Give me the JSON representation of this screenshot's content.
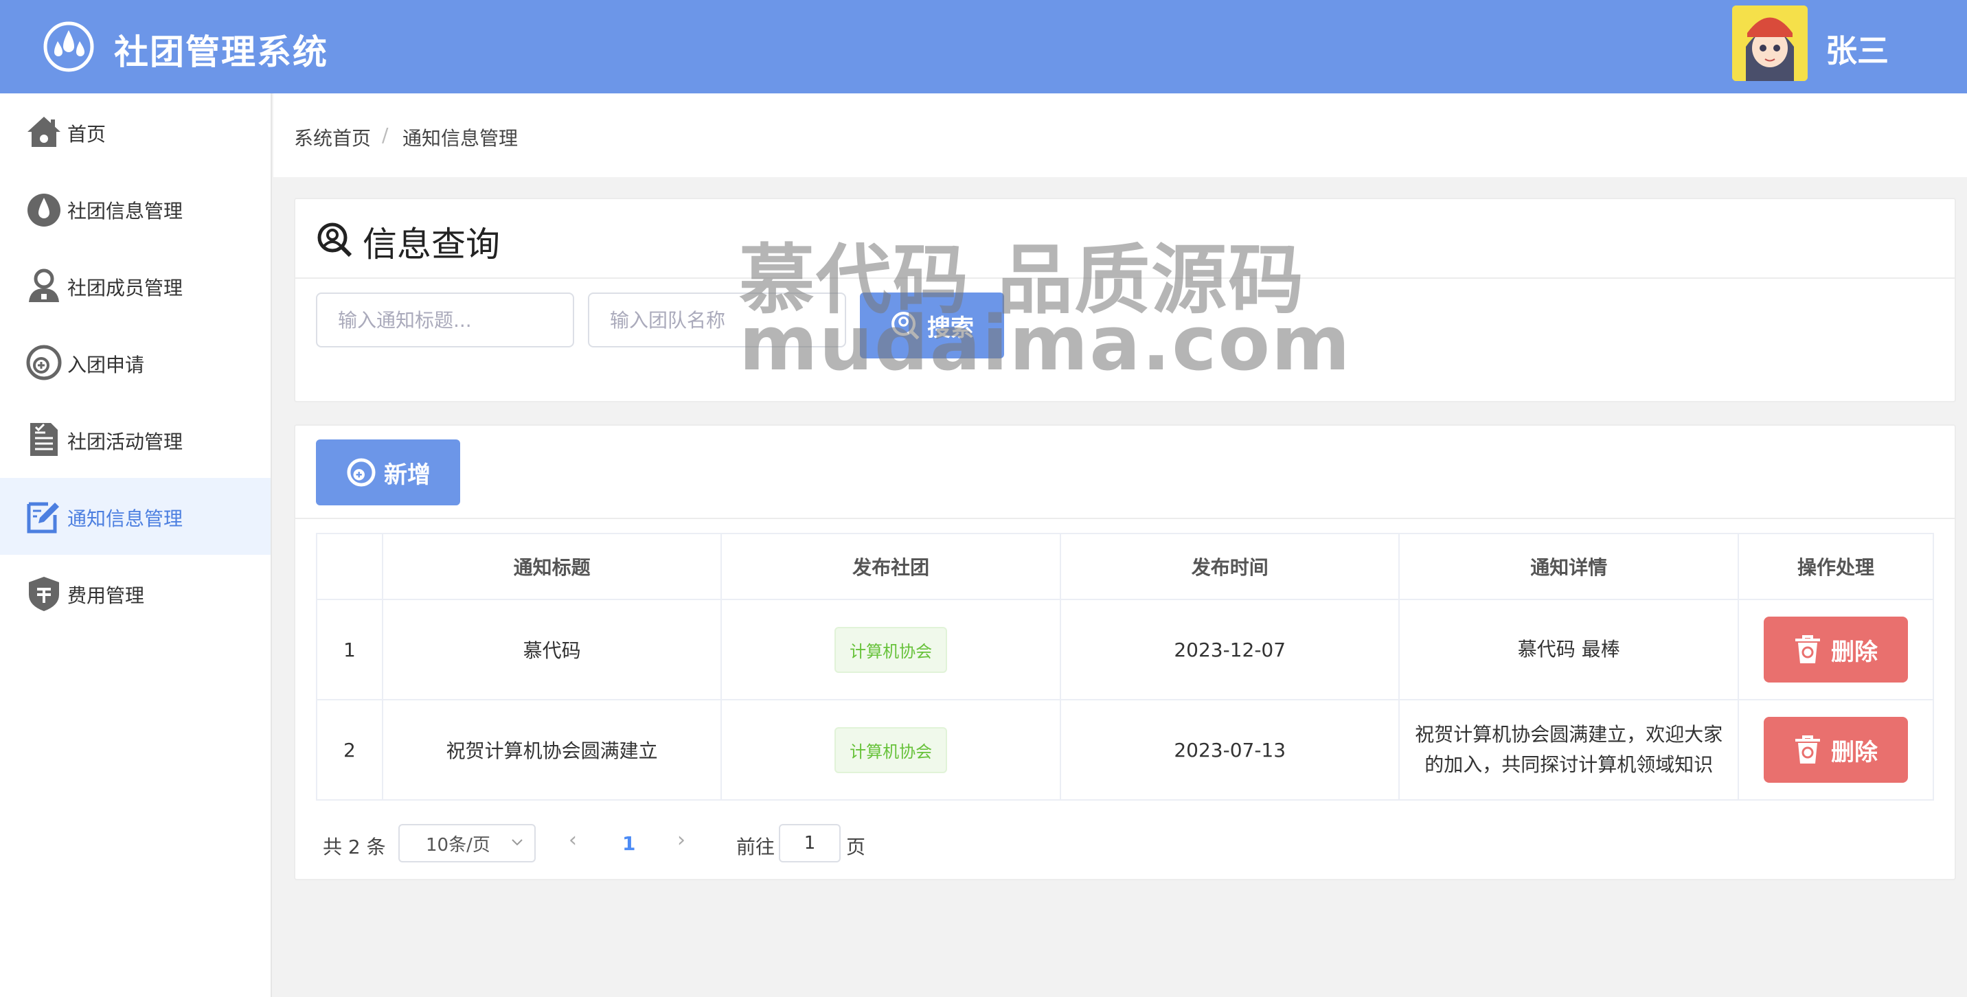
{
  "header": {
    "app_title": "社团管理系统",
    "username": "张三"
  },
  "sidebar": {
    "items": [
      {
        "label": "首页",
        "icon": "home-icon"
      },
      {
        "label": "社团信息管理",
        "icon": "drop-icon"
      },
      {
        "label": "社团成员管理",
        "icon": "user-icon"
      },
      {
        "label": "入团申请",
        "icon": "add-circle-icon"
      },
      {
        "label": "社团活动管理",
        "icon": "document-icon"
      },
      {
        "label": "通知信息管理",
        "icon": "edit-icon",
        "active": true
      },
      {
        "label": "费用管理",
        "icon": "shield-icon"
      }
    ]
  },
  "breadcrumb": {
    "home": "系统首页",
    "separator": "/",
    "current": "通知信息管理"
  },
  "search_panel": {
    "title": "信息查询",
    "title_placeholder": "输入通知标题...",
    "team_placeholder": "输入团队名称",
    "search_label": "搜索"
  },
  "toolbar": {
    "add_label": "新增"
  },
  "table": {
    "headers": [
      "",
      "通知标题",
      "发布社团",
      "发布时间",
      "通知详情",
      "操作处理"
    ],
    "rows": [
      {
        "index": "1",
        "title": "慕代码",
        "club": "计算机协会",
        "time": "2023-12-07",
        "detail": "慕代码 最棒",
        "action": "删除"
      },
      {
        "index": "2",
        "title": "祝贺计算机协会圆满建立",
        "club": "计算机协会",
        "time": "2023-07-13",
        "detail": "祝贺计算机协会圆满建立，欢迎大家的加入，共同探讨计算机领域知识",
        "action": "删除"
      }
    ]
  },
  "pagination": {
    "total": "共 2 条",
    "page_size": "10条/页",
    "prev": "‹",
    "current": "1",
    "next": "›",
    "goto_prefix": "前往",
    "goto_value": "1",
    "goto_suffix": "页"
  },
  "watermark": {
    "line1": "慕代码 品质源码",
    "line2": "mudaima.com"
  },
  "colors": {
    "header": "#6c96e8",
    "danger": "#e9706e",
    "active_bg": "#ecf3fe",
    "tag_green": "#67c23a"
  }
}
